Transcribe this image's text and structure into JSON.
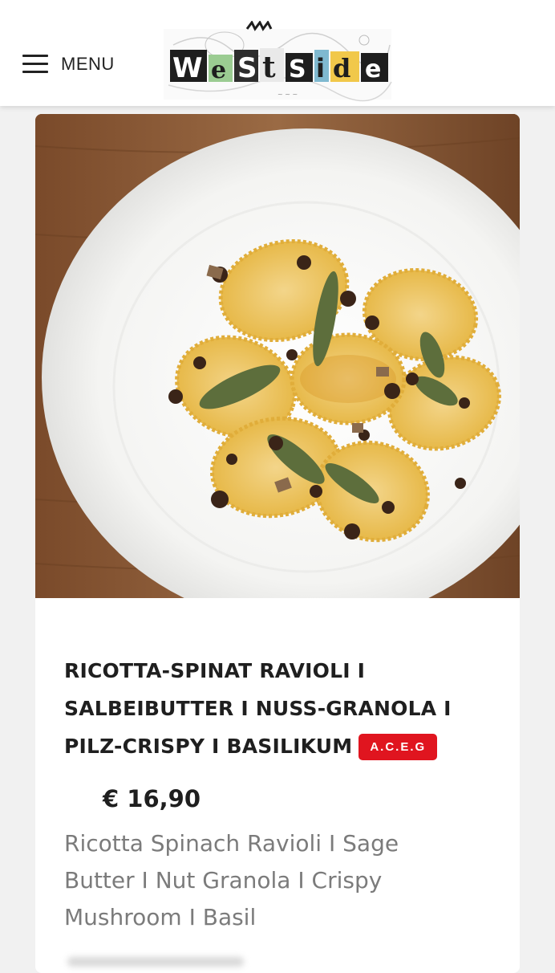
{
  "header": {
    "menu_label": "MENU",
    "logo_text": "WeStSide"
  },
  "dish": {
    "title": "RICOTTA-SPINAT RAVIOLI I SALBEIBUTTER I NUSS-GRANOLA I PILZ-CRISPY I BASILIKUM",
    "allergens": "A.C.E.G",
    "price": "€ 16,90",
    "description": "Ricotta Spinach Ravioli I Sage Butter I Nut Granola I Crispy Mushroom I Basil",
    "image_alt": "ravioli-dish-photo"
  },
  "colors": {
    "allergen_badge": "#e0151f",
    "title_text": "#1f1f1f",
    "description_text": "#7b7b7b",
    "page_background": "#f1f1f1"
  }
}
